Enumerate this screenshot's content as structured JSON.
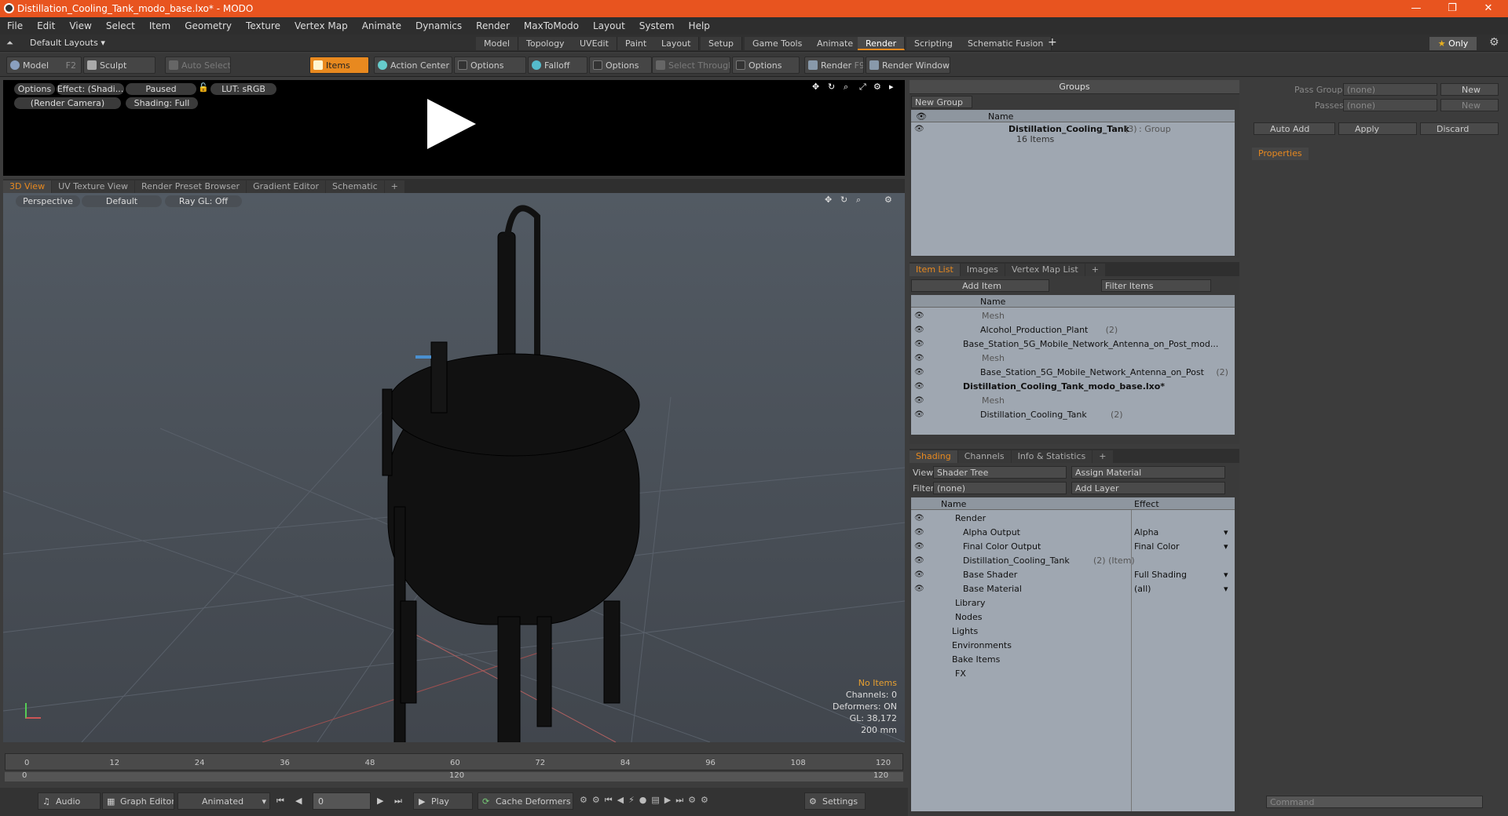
{
  "app": {
    "title": "Distillation_Cooling_Tank_modo_base.lxo* - MODO"
  },
  "menu": [
    "File",
    "Edit",
    "View",
    "Select",
    "Item",
    "Geometry",
    "Texture",
    "Vertex Map",
    "Animate",
    "Dynamics",
    "Render",
    "MaxToModo",
    "Layout",
    "System",
    "Help"
  ],
  "layouts": {
    "default_label": "Default Layouts",
    "tabs": [
      "Model",
      "Topology",
      "UVEdit",
      "Paint",
      "Layout",
      "Setup",
      "Game Tools",
      "Animate",
      "Render",
      "Scripting",
      "Schematic Fusion"
    ],
    "active": "Render",
    "only": "Only"
  },
  "toolbar": {
    "model": "Model",
    "model_key": "F2",
    "sculpt": "Sculpt",
    "auto_select": "Auto Select",
    "items": "Items",
    "action_center": "Action Center",
    "options1": "Options",
    "falloff": "Falloff",
    "options2": "Options",
    "select_through": "Select Through",
    "options3": "Options",
    "render": "Render",
    "render_key": "F9",
    "render_window": "Render Window"
  },
  "preview": {
    "options": "Options",
    "effect": "Effect: (Shadi...",
    "paused": "Paused",
    "lut": "LUT: sRGB",
    "camera": "(Render Camera)",
    "shading": "Shading: Full"
  },
  "view_tabs": [
    "3D View",
    "UV Texture View",
    "Render Preset Browser",
    "Gradient Editor",
    "Schematic"
  ],
  "viewport": {
    "perspective": "Perspective",
    "default": "Default",
    "raygl": "Ray GL: Off",
    "no_items": "No Items",
    "channels": "Channels: 0",
    "deformers": "Deformers: ON",
    "gl": "GL: 38,172",
    "scale": "200 mm"
  },
  "timeline": {
    "ticks": [
      "0",
      "12",
      "24",
      "36",
      "48",
      "60",
      "72",
      "84",
      "96",
      "108",
      "120"
    ],
    "sub_start": "0",
    "sub_mid": "120",
    "sub_end": "120"
  },
  "bottombar": {
    "audio": "Audio",
    "graph_editor": "Graph Editor",
    "animated": "Animated",
    "frame": "0",
    "play": "Play",
    "cache": "Cache Deformers",
    "settings": "Settings"
  },
  "groups": {
    "header": "Groups",
    "new_group": "New Group",
    "col_name": "Name",
    "item_name": "Distillation_Cooling_Tank",
    "item_count": "(3)",
    "item_type": ": Group",
    "item_sub": "16 Items"
  },
  "itemlist": {
    "tabs": [
      "Item List",
      "Images",
      "Vertex Map List"
    ],
    "add_item": "Add Item",
    "filter": "Filter Items",
    "col_name": "Name",
    "rows": [
      {
        "t": "Mesh",
        "i": 90,
        "g": true
      },
      {
        "t": "Alcohol_Production_Plant",
        "c": "(2)",
        "i": 88
      },
      {
        "t": "Base_Station_5G_Mobile_Network_Antenna_on_Post_mod...",
        "i": 66
      },
      {
        "t": "Mesh",
        "i": 90,
        "g": true
      },
      {
        "t": "Base_Station_5G_Mobile_Network_Antenna_on_Post",
        "c": "(2)",
        "i": 88
      },
      {
        "t": "Distillation_Cooling_Tank_modo_base.lxo*",
        "i": 66,
        "b": true
      },
      {
        "t": "Mesh",
        "i": 90,
        "g": true
      },
      {
        "t": "Distillation_Cooling_Tank",
        "c": "(2)",
        "i": 88
      }
    ]
  },
  "shading": {
    "tabs": [
      "Shading",
      "Channels",
      "Info & Statistics"
    ],
    "view_label": "View",
    "view_value": "Shader Tree",
    "assign": "Assign Material",
    "filter_label": "Filter",
    "filter_value": "(none)",
    "add_layer": "Add Layer",
    "col_name": "Name",
    "col_effect": "Effect",
    "rows": [
      {
        "t": "Render",
        "e": "",
        "i": 56
      },
      {
        "t": "Alpha Output",
        "e": "Alpha",
        "i": 66
      },
      {
        "t": "Final Color Output",
        "e": "Final Color",
        "i": 66
      },
      {
        "t": "Distillation_Cooling_Tank",
        "c": "(2) (Item)",
        "e": "",
        "i": 66
      },
      {
        "t": "Base Shader",
        "e": "Full Shading",
        "i": 66
      },
      {
        "t": "Base Material",
        "e": "(all)",
        "i": 66
      },
      {
        "t": "Library",
        "e": "",
        "i": 56
      },
      {
        "t": "Nodes",
        "e": "",
        "i": 56
      },
      {
        "t": "Lights",
        "e": "",
        "i": 52
      },
      {
        "t": "Environments",
        "e": "",
        "i": 52
      },
      {
        "t": "Bake Items",
        "e": "",
        "i": 52
      },
      {
        "t": "FX",
        "e": "",
        "i": 56
      }
    ]
  },
  "props": {
    "pass_groups": "Pass Groups",
    "pass_groups_val": "(none)",
    "passes": "Passes",
    "passes_val": "(none)",
    "new": "New",
    "new2": "New",
    "auto_add": "Auto Add",
    "apply": "Apply",
    "discard": "Discard",
    "tab": "Properties",
    "command": "Command"
  }
}
